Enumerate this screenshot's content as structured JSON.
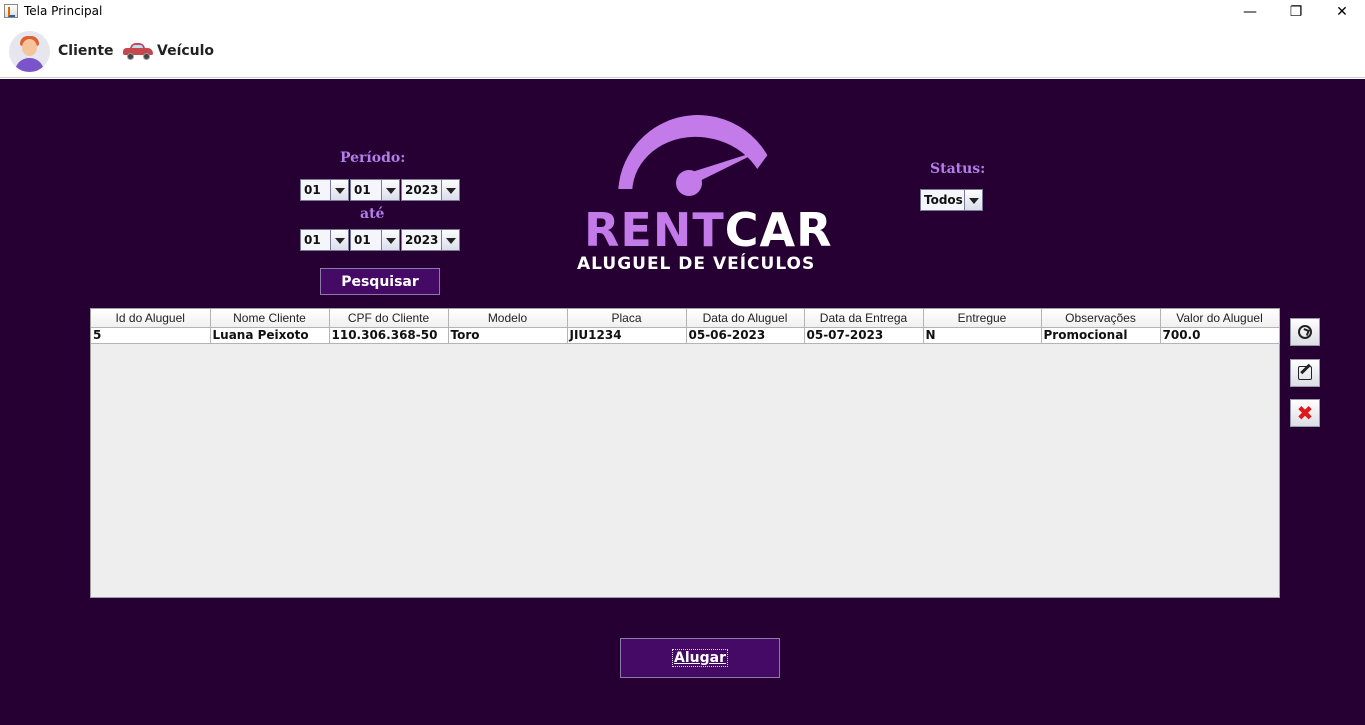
{
  "window": {
    "title": "Tela Principal",
    "min_icon": "minimize-icon",
    "max_icon": "restore-icon",
    "close_icon": "close-icon"
  },
  "menu": {
    "cliente_label": "Cliente",
    "veiculo_label": "Veículo"
  },
  "filters": {
    "periodo_label": "Período:",
    "ate_label": "até",
    "from": {
      "day": "01",
      "month": "01",
      "year": "2023"
    },
    "to": {
      "day": "01",
      "month": "01",
      "year": "2023"
    },
    "pesquisar_label": "Pesquisar",
    "status_label": "Status:",
    "status_value": "Todos"
  },
  "logo": {
    "rent": "RENT",
    "car": "CAR",
    "subtitle": "ALUGUEL DE VEÍCULOS"
  },
  "table": {
    "headers": [
      "Id do Aluguel",
      "Nome Cliente",
      "CPF do Cliente",
      "Modelo",
      "Placa",
      "Data do Aluguel",
      "Data da Entrega",
      "Entregue",
      "Observações",
      "Valor do Aluguel"
    ],
    "rows": [
      [
        "5",
        "Luana Peixoto",
        "110.306.368-50",
        "Toro",
        "JIU1234",
        "05-06-2023",
        "05-07-2023",
        "N",
        "Promocional",
        "700.0"
      ]
    ]
  },
  "actions": {
    "alugar_label": "Alugar"
  },
  "colors": {
    "background": "#260033",
    "accent": "#c27be8",
    "button": "#450a66"
  }
}
